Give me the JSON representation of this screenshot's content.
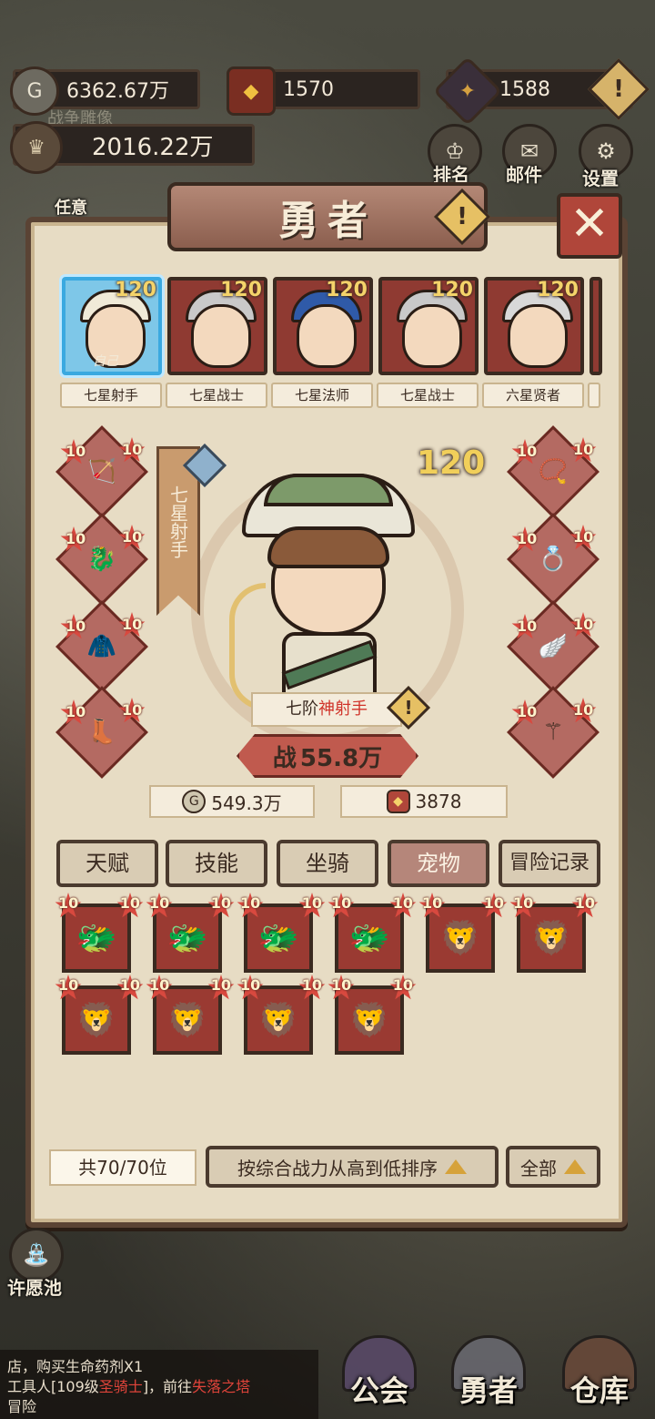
{
  "resources": {
    "gold": "6362.67万",
    "badge": "1570",
    "crystal": "1588",
    "power": "2016.22万",
    "faded_label": "战争雕像"
  },
  "side_buttons": {
    "rank_label": "排名",
    "mail_label": "邮件",
    "settings_label": "设置",
    "wish_label": "许愿池",
    "task_label": "任意"
  },
  "title": "勇者",
  "heroes": [
    {
      "name": "七星射手",
      "level": "120",
      "tag": "自己",
      "selected": true
    },
    {
      "name": "七星战士",
      "level": "120",
      "tag": ""
    },
    {
      "name": "七星法师",
      "level": "120",
      "tag": ""
    },
    {
      "name": "七星战士",
      "level": "120",
      "tag": ""
    },
    {
      "name": "六星贤者",
      "level": "120",
      "tag": ""
    }
  ],
  "current_hero": {
    "class_label": "七星射手",
    "level": "120",
    "rank_prefix": "七阶",
    "rank_title": "神射手",
    "power_label": "战",
    "power_value": "55.8万",
    "gold_stat": "549.3万",
    "badge_stat": "3878"
  },
  "equipment_left": [
    {
      "lv_a": "10",
      "lv_b": "10",
      "icon": "bow"
    },
    {
      "lv_a": "10",
      "lv_b": "10",
      "icon": "dragon-armor"
    },
    {
      "lv_a": "10",
      "lv_b": "10",
      "icon": "cloak"
    },
    {
      "lv_a": "10",
      "lv_b": "10",
      "icon": "boots"
    }
  ],
  "equipment_right": [
    {
      "lv_a": "10",
      "lv_b": "10",
      "icon": "necklace"
    },
    {
      "lv_a": "10",
      "lv_b": "10",
      "icon": "ring"
    },
    {
      "lv_a": "10",
      "lv_b": "10",
      "icon": "wings"
    },
    {
      "lv_a": "10",
      "lv_b": "10",
      "icon": "staff"
    }
  ],
  "tabs": [
    {
      "label": "天赋",
      "active": false
    },
    {
      "label": "技能",
      "active": false
    },
    {
      "label": "坐骑",
      "active": false
    },
    {
      "label": "宠物",
      "active": true
    },
    {
      "label": "冒险记录",
      "active": false
    }
  ],
  "pets": [
    {
      "type": "ice",
      "lv_a": "10",
      "lv_b": "10"
    },
    {
      "type": "ice",
      "lv_a": "10",
      "lv_b": "10"
    },
    {
      "type": "ice",
      "lv_a": "10",
      "lv_b": "10"
    },
    {
      "type": "ice",
      "lv_a": "10",
      "lv_b": "10"
    },
    {
      "type": "gold",
      "lv_a": "10",
      "lv_b": "10"
    },
    {
      "type": "gold",
      "lv_a": "10",
      "lv_b": "10"
    },
    {
      "type": "gold",
      "lv_a": "10",
      "lv_b": "10"
    },
    {
      "type": "gold",
      "lv_a": "10",
      "lv_b": "10"
    },
    {
      "type": "gold",
      "lv_a": "10",
      "lv_b": "10"
    },
    {
      "type": "gold",
      "lv_a": "10",
      "lv_b": "10"
    }
  ],
  "footer": {
    "count": "共70/70位",
    "sort_label": "按综合战力从高到低排序",
    "filter_label": "全部"
  },
  "chat": {
    "line1": "店，购买生命药剂X1",
    "line2_a": "工具人[109级",
    "line2_b": "圣骑士",
    "line2_c": "]，前往",
    "line2_d": "失落之塔",
    "line3": "冒险"
  },
  "nav": {
    "guild": "公会",
    "heroes": "勇者",
    "warehouse": "仓库"
  },
  "colors": {
    "panel": "#e7dcc4",
    "frame": "#5a4334",
    "accent_red": "#9a3a32",
    "highlight": "#d0342a",
    "selected_blue": "#7ec7e8"
  }
}
